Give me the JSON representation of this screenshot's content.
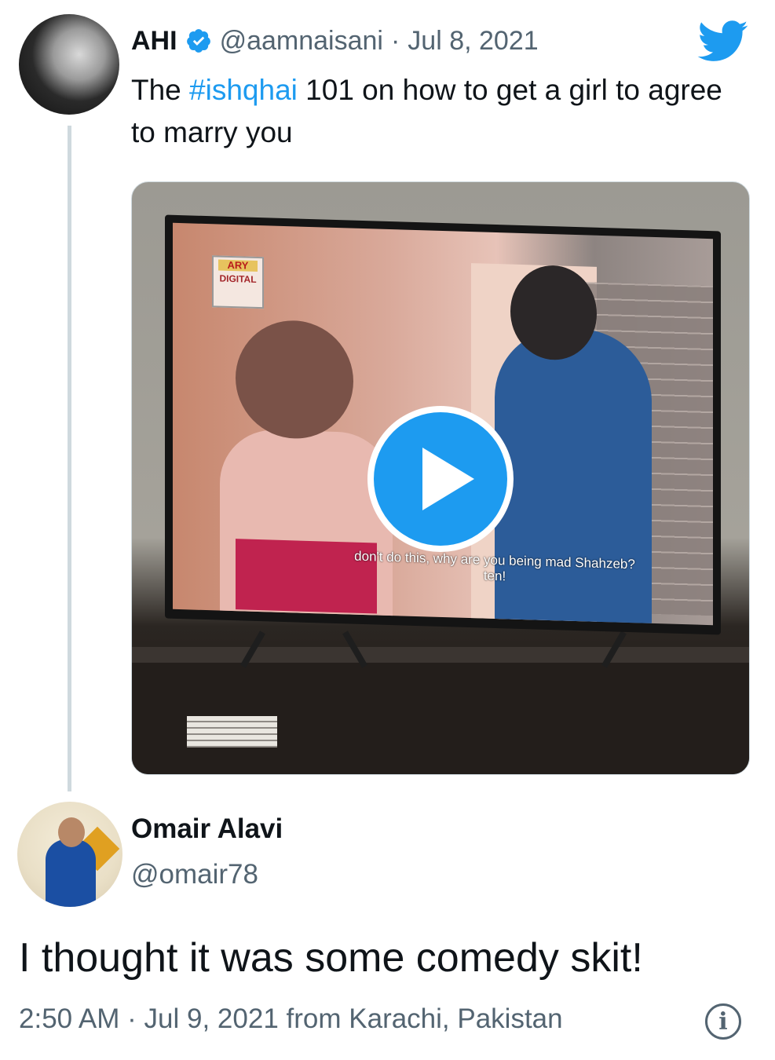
{
  "tweet1": {
    "display_name": "AHI",
    "handle": "@aamnaisani",
    "separator": "·",
    "date": "Jul 8, 2021",
    "text_before": "The ",
    "hashtag": "#ishqhai",
    "text_after": " 101 on how to get a girl to agree to marry you",
    "media": {
      "type": "video",
      "channel_logo_top": "ARY",
      "channel_logo_bottom": "DIGITAL",
      "subtitle_line1": "don't do this, why are you being mad Shahzeb?",
      "subtitle_line2": "ten!"
    }
  },
  "tweet2": {
    "display_name": "Omair Alavi",
    "handle": "@omair78",
    "text": "I thought it was some comedy skit!",
    "time": "2:50 AM",
    "separator": "·",
    "date": "Jul 9, 2021",
    "source": "from Karachi, Pakistan"
  },
  "icons": {
    "verified": "verified-badge-icon",
    "brand": "twitter-bird-icon",
    "play": "play-icon",
    "info": "info-icon"
  },
  "colors": {
    "accent": "#1d9bf0",
    "text": "#0f1419",
    "secondary": "#536471",
    "thread_line": "#cfd9de"
  }
}
